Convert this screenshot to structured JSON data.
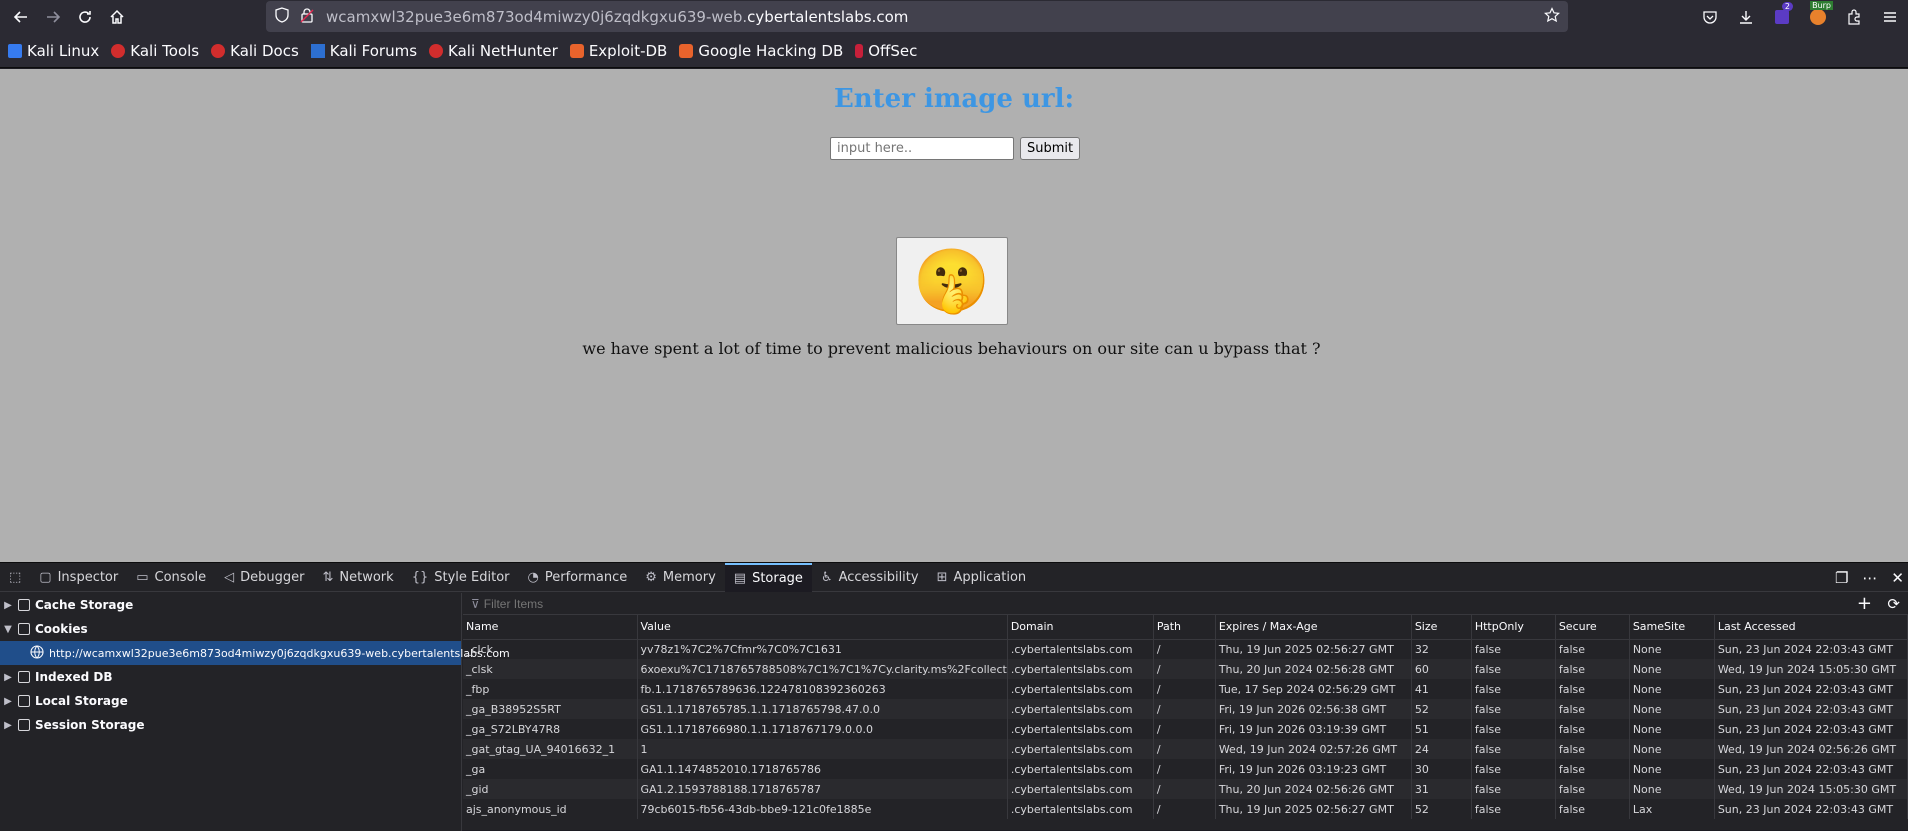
{
  "browser": {
    "url_prefix": "wcamxwl32pue3e6m873od4miwzy0j6zqdkgxu639-web.",
    "url_domain": "cybertalentslabs.com",
    "bookmarks": [
      "Kali Linux",
      "Kali Tools",
      "Kali Docs",
      "Kali Forums",
      "Kali NetHunter",
      "Exploit-DB",
      "Google Hacking DB",
      "OffSec"
    ],
    "ext_badge": "2",
    "burp_label": "Burp"
  },
  "page": {
    "heading": "Enter image url:",
    "input_placeholder": "input here..",
    "submit_label": "Submit",
    "emoji": "🤫",
    "message": "we have spent a lot of time to prevent malicious behaviours on our site can u bypass that ?"
  },
  "devtools": {
    "tabs": [
      "Inspector",
      "Console",
      "Debugger",
      "Network",
      "Style Editor",
      "Performance",
      "Memory",
      "Storage",
      "Accessibility",
      "Application"
    ],
    "active_tab": "Storage",
    "tree": [
      "Cache Storage",
      "Cookies",
      "Indexed DB",
      "Local Storage",
      "Session Storage"
    ],
    "selected_host": "http://wcamxwl32pue3e6m873od4miwzy0j6zqdkgxu639-web.cybertalentslabs.com",
    "filter_placeholder": "Filter Items",
    "columns": [
      "Name",
      "Value",
      "Domain",
      "Path",
      "Expires / Max-Age",
      "Size",
      "HttpOnly",
      "Secure",
      "SameSite",
      "Last Accessed"
    ],
    "rows": [
      [
        "_clck",
        "yv78z1%7C2%7Cfmr%7C0%7C1631",
        ".cybertalentslabs.com",
        "/",
        "Thu, 19 Jun 2025 02:56:27 GMT",
        "32",
        "false",
        "false",
        "None",
        "Sun, 23 Jun 2024 22:03:43 GMT"
      ],
      [
        "_clsk",
        "6xoexu%7C1718765788508%7C1%7C1%7Cy.clarity.ms%2Fcollect",
        ".cybertalentslabs.com",
        "/",
        "Thu, 20 Jun 2024 02:56:28 GMT",
        "60",
        "false",
        "false",
        "None",
        "Wed, 19 Jun 2024 15:05:30 GMT"
      ],
      [
        "_fbp",
        "fb.1.1718765789636.122478108392360263",
        ".cybertalentslabs.com",
        "/",
        "Tue, 17 Sep 2024 02:56:29 GMT",
        "41",
        "false",
        "false",
        "None",
        "Sun, 23 Jun 2024 22:03:43 GMT"
      ],
      [
        "_ga_B38952S5RT",
        "GS1.1.1718765785.1.1.1718765798.47.0.0",
        ".cybertalentslabs.com",
        "/",
        "Fri, 19 Jun 2026 02:56:38 GMT",
        "52",
        "false",
        "false",
        "None",
        "Sun, 23 Jun 2024 22:03:43 GMT"
      ],
      [
        "_ga_S72LBY47R8",
        "GS1.1.1718766980.1.1.1718767179.0.0.0",
        ".cybertalentslabs.com",
        "/",
        "Fri, 19 Jun 2026 03:19:39 GMT",
        "51",
        "false",
        "false",
        "None",
        "Sun, 23 Jun 2024 22:03:43 GMT"
      ],
      [
        "_gat_gtag_UA_94016632_1",
        "1",
        ".cybertalentslabs.com",
        "/",
        "Wed, 19 Jun 2024 02:57:26 GMT",
        "24",
        "false",
        "false",
        "None",
        "Wed, 19 Jun 2024 02:56:26 GMT"
      ],
      [
        "_ga",
        "GA1.1.1474852010.1718765786",
        ".cybertalentslabs.com",
        "/",
        "Fri, 19 Jun 2026 03:19:23 GMT",
        "30",
        "false",
        "false",
        "None",
        "Sun, 23 Jun 2024 22:03:43 GMT"
      ],
      [
        "_gid",
        "GA1.2.1593788188.1718765787",
        ".cybertalentslabs.com",
        "/",
        "Thu, 20 Jun 2024 02:56:26 GMT",
        "31",
        "false",
        "false",
        "None",
        "Wed, 19 Jun 2024 15:05:30 GMT"
      ],
      [
        "ajs_anonymous_id",
        "79cb6015-fb56-43db-bbe9-121c0fe1885e",
        ".cybertalentslabs.com",
        "/",
        "Thu, 19 Jun 2025 02:56:27 GMT",
        "52",
        "false",
        "false",
        "Lax",
        "Sun, 23 Jun 2024 22:03:43 GMT"
      ]
    ]
  }
}
